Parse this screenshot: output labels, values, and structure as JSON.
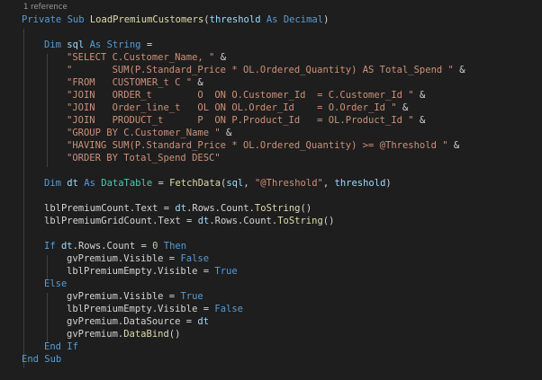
{
  "reference_label": "1 reference",
  "lines": [
    {
      "indent": 0,
      "tokens": [
        [
          "kw",
          "Private Sub "
        ],
        [
          "fn",
          "LoadPremiumCustomers"
        ],
        [
          "pl",
          "("
        ],
        [
          "id",
          "threshold"
        ],
        [
          "kw",
          " As "
        ],
        [
          "kw",
          "Decimal"
        ],
        [
          "pl",
          ")"
        ]
      ]
    },
    {
      "indent": 0,
      "tokens": []
    },
    {
      "indent": 1,
      "tokens": [
        [
          "kw",
          "Dim "
        ],
        [
          "id",
          "sql"
        ],
        [
          "kw",
          " As "
        ],
        [
          "kw",
          "String"
        ],
        [
          "pl",
          " ="
        ]
      ]
    },
    {
      "indent": 2,
      "tokens": [
        [
          "str",
          "\"SELECT C.Customer_Name, \""
        ],
        [
          "pl",
          " &"
        ]
      ]
    },
    {
      "indent": 2,
      "tokens": [
        [
          "str",
          "\"       SUM(P.Standard_Price * OL.Ordered_Quantity) AS Total_Spend \""
        ],
        [
          "pl",
          " &"
        ]
      ]
    },
    {
      "indent": 2,
      "tokens": [
        [
          "str",
          "\"FROM   CUSTOMER_t C \""
        ],
        [
          "pl",
          " &"
        ]
      ]
    },
    {
      "indent": 2,
      "tokens": [
        [
          "str",
          "\"JOIN   ORDER_t        O  ON O.Customer_Id  = C.Customer_Id \""
        ],
        [
          "pl",
          " &"
        ]
      ]
    },
    {
      "indent": 2,
      "tokens": [
        [
          "str",
          "\"JOIN   Order_line_t   OL ON OL.Order_Id    = O.Order_Id \""
        ],
        [
          "pl",
          " &"
        ]
      ]
    },
    {
      "indent": 2,
      "tokens": [
        [
          "str",
          "\"JOIN   PRODUCT_t      P  ON P.Product_Id   = OL.Product_Id \""
        ],
        [
          "pl",
          " &"
        ]
      ]
    },
    {
      "indent": 2,
      "tokens": [
        [
          "str",
          "\"GROUP BY C.Customer_Name \""
        ],
        [
          "pl",
          " &"
        ]
      ]
    },
    {
      "indent": 2,
      "tokens": [
        [
          "str",
          "\"HAVING SUM(P.Standard_Price * OL.Ordered_Quantity) >= @Threshold \""
        ],
        [
          "pl",
          " &"
        ]
      ]
    },
    {
      "indent": 2,
      "tokens": [
        [
          "str",
          "\"ORDER BY Total_Spend DESC\""
        ]
      ]
    },
    {
      "indent": 0,
      "tokens": []
    },
    {
      "indent": 1,
      "tokens": [
        [
          "kw",
          "Dim "
        ],
        [
          "id",
          "dt"
        ],
        [
          "kw",
          " As "
        ],
        [
          "tp",
          "DataTable"
        ],
        [
          "pl",
          " = "
        ],
        [
          "fn",
          "FetchData"
        ],
        [
          "pl",
          "("
        ],
        [
          "id",
          "sql"
        ],
        [
          "pl",
          ", "
        ],
        [
          "str",
          "\"@Threshold\""
        ],
        [
          "pl",
          ", "
        ],
        [
          "id",
          "threshold"
        ],
        [
          "pl",
          ")"
        ]
      ]
    },
    {
      "indent": 0,
      "tokens": []
    },
    {
      "indent": 1,
      "tokens": [
        [
          "pl",
          "lblPremiumCount.Text = "
        ],
        [
          "id",
          "dt"
        ],
        [
          "pl",
          ".Rows.Count."
        ],
        [
          "fn",
          "ToString"
        ],
        [
          "pl",
          "()"
        ]
      ]
    },
    {
      "indent": 1,
      "tokens": [
        [
          "pl",
          "lblPremiumGridCount.Text = "
        ],
        [
          "id",
          "dt"
        ],
        [
          "pl",
          ".Rows.Count."
        ],
        [
          "fn",
          "ToString"
        ],
        [
          "pl",
          "()"
        ]
      ]
    },
    {
      "indent": 0,
      "tokens": []
    },
    {
      "indent": 1,
      "tokens": [
        [
          "kw",
          "If "
        ],
        [
          "id",
          "dt"
        ],
        [
          "pl",
          ".Rows.Count = "
        ],
        [
          "num",
          "0"
        ],
        [
          "kw",
          " Then"
        ]
      ]
    },
    {
      "indent": 2,
      "tokens": [
        [
          "pl",
          "gvPremium.Visible = "
        ],
        [
          "kw",
          "False"
        ]
      ]
    },
    {
      "indent": 2,
      "tokens": [
        [
          "pl",
          "lblPremiumEmpty.Visible = "
        ],
        [
          "kw",
          "True"
        ]
      ]
    },
    {
      "indent": 1,
      "tokens": [
        [
          "kw",
          "Else"
        ]
      ]
    },
    {
      "indent": 2,
      "tokens": [
        [
          "pl",
          "gvPremium.Visible = "
        ],
        [
          "kw",
          "True"
        ]
      ]
    },
    {
      "indent": 2,
      "tokens": [
        [
          "pl",
          "lblPremiumEmpty.Visible = "
        ],
        [
          "kw",
          "False"
        ]
      ]
    },
    {
      "indent": 2,
      "tokens": [
        [
          "pl",
          "gvPremium.DataSource = "
        ],
        [
          "id",
          "dt"
        ]
      ]
    },
    {
      "indent": 2,
      "tokens": [
        [
          "pl",
          "gvPremium."
        ],
        [
          "fn",
          "DataBind"
        ],
        [
          "pl",
          "()"
        ]
      ]
    },
    {
      "indent": 1,
      "tokens": [
        [
          "kw",
          "End If"
        ]
      ]
    },
    {
      "indent": 0,
      "tokens": [
        [
          "kw",
          "End Sub"
        ]
      ]
    }
  ]
}
